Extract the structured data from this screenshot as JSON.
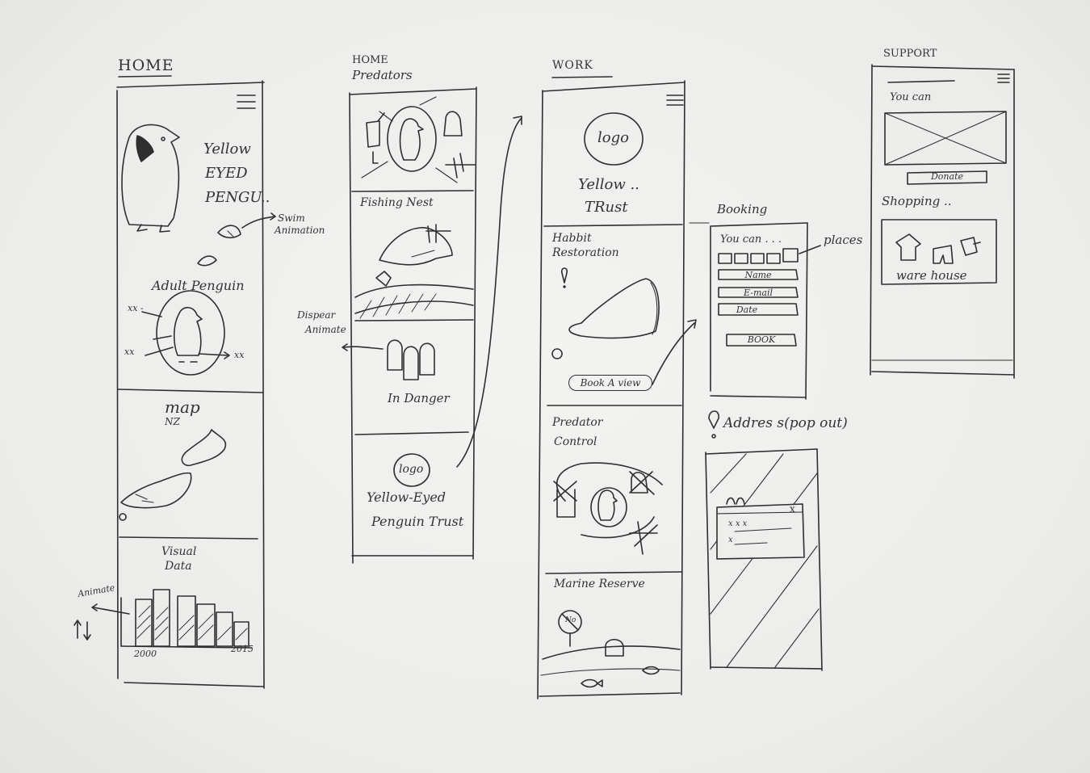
{
  "frames": {
    "home": {
      "title": "HOME",
      "hero_text": [
        "Yellow",
        "EYED",
        "PENGU.."
      ],
      "swim_note": [
        "Swim",
        "Animation"
      ],
      "adult_penguin": "Adult Penguin",
      "xx_labels": [
        "xx -",
        "xx",
        "xx"
      ],
      "map_title": "map",
      "map_subtitle": "NZ",
      "visual_data": [
        "Visual",
        "Data"
      ],
      "animate_note": "Animate",
      "year_start": "2000",
      "year_end": "2015"
    },
    "predators": {
      "title": [
        "HOME",
        "Predators"
      ],
      "fishing_nest": "Fishing Nest",
      "dispear_note": [
        "Dispear",
        "Animate"
      ],
      "in_danger": "In Danger",
      "logo": "logo",
      "trust_name": [
        "Yellow-Eyed",
        "Penguin Trust"
      ]
    },
    "work": {
      "title": "WORK",
      "logo": "logo",
      "trust_name": [
        "Yellow ..",
        "TRust"
      ],
      "habitat": [
        "Habbit",
        "Restoration"
      ],
      "book_button": "Book A view",
      "predator_control": [
        "Predator",
        "Control"
      ],
      "marine_reserve": "Marine Reserve",
      "no_sign": "No"
    },
    "booking": {
      "title": "Booking",
      "you_can": "You can . . .",
      "places_note": "places",
      "fields": [
        "Name",
        "E-mail",
        "Date"
      ],
      "book_button": "BOOK"
    },
    "address": {
      "title": "Addres s(pop out)",
      "close": "x",
      "rows": [
        "x x x",
        "x"
      ]
    },
    "support": {
      "title": "SUPPORT",
      "you_can": "You can",
      "donate_button": "Donate",
      "shopping": "Shopping ..",
      "warehouse": "ware house"
    }
  }
}
